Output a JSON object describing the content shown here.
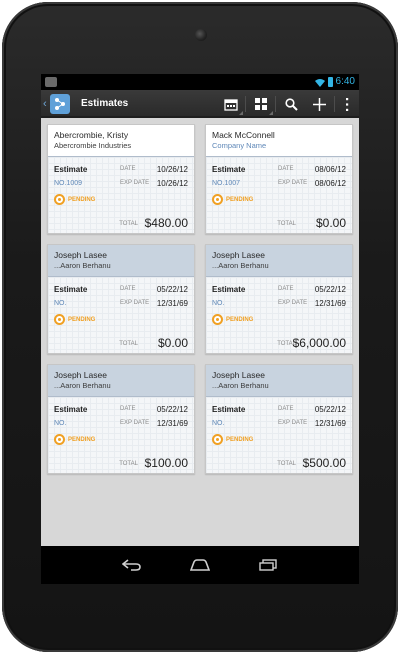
{
  "status": {
    "time": "6:40"
  },
  "actionbar": {
    "title": "Estimates"
  },
  "cards": [
    {
      "name": "Abercrombie, Kristy",
      "sub": "Abercrombie Industries",
      "sub_is_link": false,
      "selected": true,
      "type": "Estimate",
      "number": "NO.1009",
      "date_label": "DATE",
      "date": "10/26/12",
      "exp_label": "EXP DATE",
      "exp_date": "10/26/12",
      "status": "PENDING",
      "total_label": "TOTAL",
      "total": "$480.00"
    },
    {
      "name": "Mack McConnell",
      "sub": "Company Name",
      "sub_is_link": true,
      "selected": true,
      "type": "Estimate",
      "number": "NO.1007",
      "date_label": "DATE",
      "date": "08/06/12",
      "exp_label": "EXP DATE",
      "exp_date": "08/06/12",
      "status": "PENDING",
      "total_label": "TOTAL",
      "total": "$0.00"
    },
    {
      "name": "Joseph Lasee",
      "sub": "...Aaron Berhanu",
      "sub_is_link": false,
      "selected": false,
      "type": "Estimate",
      "number": "NO.",
      "date_label": "DATE",
      "date": "05/22/12",
      "exp_label": "EXP DATE",
      "exp_date": "12/31/69",
      "status": "PENDING",
      "total_label": "TOTAL",
      "total": "$0.00"
    },
    {
      "name": "Joseph Lasee",
      "sub": "...Aaron Berhanu",
      "sub_is_link": false,
      "selected": false,
      "type": "Estimate",
      "number": "NO.",
      "date_label": "DATE",
      "date": "05/22/12",
      "exp_label": "EXP DATE",
      "exp_date": "12/31/69",
      "status": "PENDING",
      "total_label": "TOTAL",
      "total": "$6,000.00"
    },
    {
      "name": "Joseph Lasee",
      "sub": "...Aaron Berhanu",
      "sub_is_link": false,
      "selected": false,
      "type": "Estimate",
      "number": "NO.",
      "date_label": "DATE",
      "date": "05/22/12",
      "exp_label": "EXP DATE",
      "exp_date": "12/31/69",
      "status": "PENDING",
      "total_label": "TOTAL",
      "total": "$100.00"
    },
    {
      "name": "Joseph Lasee",
      "sub": "...Aaron Berhanu",
      "sub_is_link": false,
      "selected": false,
      "type": "Estimate",
      "number": "NO.",
      "date_label": "DATE",
      "date": "05/22/12",
      "exp_label": "EXP DATE",
      "exp_date": "12/31/69",
      "status": "PENDING",
      "total_label": "TOTAL",
      "total": "$500.00"
    }
  ],
  "colors": {
    "accent": "#33b5e5",
    "pending": "#f0a023",
    "link": "#5f88b8",
    "header": "#c8d3df"
  },
  "icons": {
    "actionbar": [
      "calendar-icon",
      "grid-view-icon",
      "search-icon",
      "add-icon",
      "overflow-menu-icon"
    ],
    "navbar": [
      "back-icon",
      "home-icon",
      "recent-apps-icon"
    ]
  }
}
